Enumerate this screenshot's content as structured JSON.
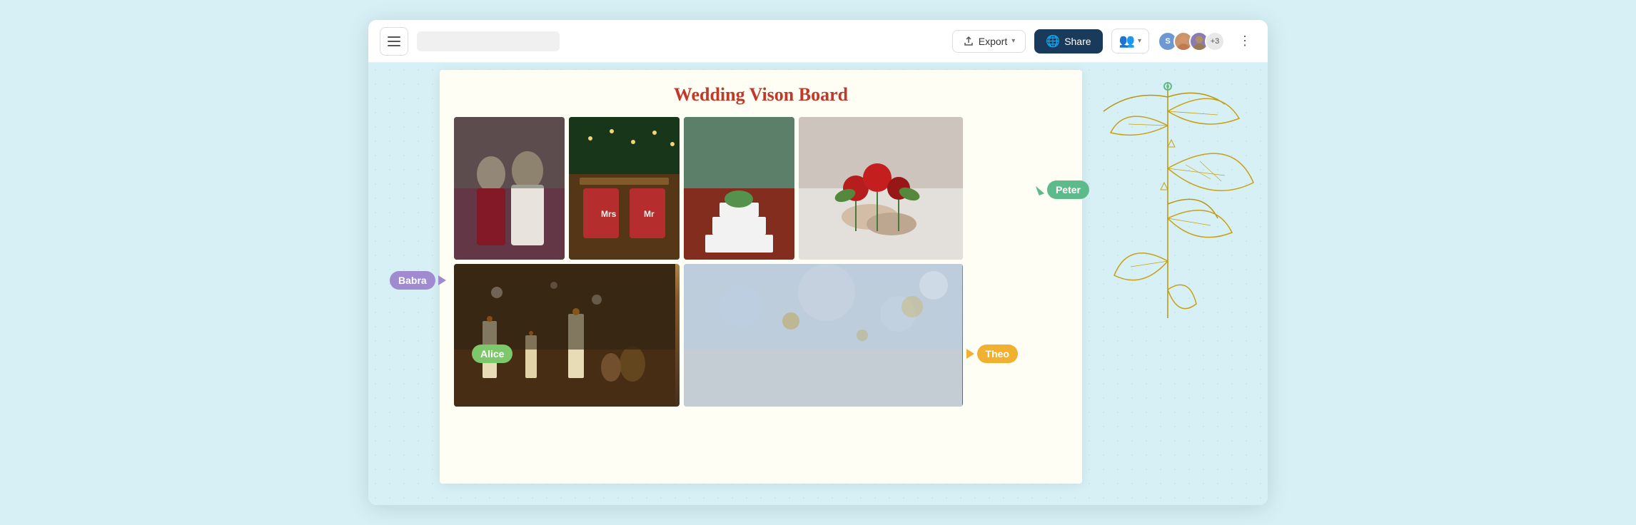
{
  "toolbar": {
    "export_label": "Export",
    "share_label": "Share",
    "collab_label": "",
    "more_label": "⋮",
    "avatar_s": "S",
    "avatar_count": "+3"
  },
  "board": {
    "title": "Wedding Vison Board",
    "cursors": {
      "peter": {
        "name": "Peter",
        "color": "#5dbb8b"
      },
      "babra": {
        "name": "Babra",
        "color": "#a08ad0"
      },
      "alice": {
        "name": "Alice",
        "color": "#7dc86a"
      },
      "theo": {
        "name": "Theo",
        "color": "#f0b030"
      }
    },
    "photos": [
      {
        "id": "photo-bridesmaids",
        "alt": "Bridesmaids in burgundy dresses"
      },
      {
        "id": "photo-table",
        "alt": "Wedding table decoration with Mr Mrs chairs"
      },
      {
        "id": "photo-cake",
        "alt": "Wedding cake with florals"
      },
      {
        "id": "photo-bouquet",
        "alt": "Bride and groom hands with rose bouquet"
      },
      {
        "id": "photo-candles",
        "alt": "Candles and pine cones winter table"
      },
      {
        "id": "photo-winter",
        "alt": "Winter wedding scene"
      }
    ]
  }
}
